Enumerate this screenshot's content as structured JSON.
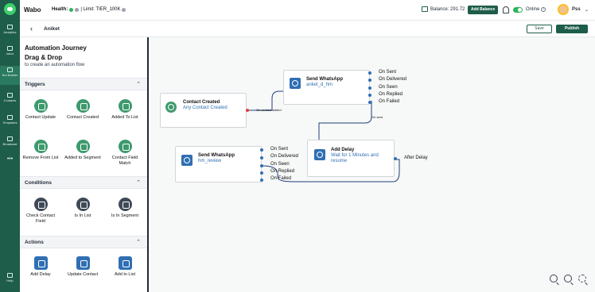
{
  "app": {
    "brand": "Wabo"
  },
  "topbar": {
    "health_label": "Health:",
    "limit_label": "| Limit: TIER_100K",
    "balance_label": "Balance: 291.72",
    "add_balance_label": "Add Balance",
    "status_label": "Online",
    "username": "Pss"
  },
  "sidebar": {
    "items": [
      {
        "label": "Analytics",
        "icon": "chart-icon"
      },
      {
        "label": "Inbox",
        "icon": "inbox-icon"
      },
      {
        "label": "Bot Builder",
        "icon": "bot-icon"
      },
      {
        "label": "Contacts",
        "icon": "contacts-icon"
      },
      {
        "label": "Templates",
        "icon": "templates-icon"
      },
      {
        "label": "Broadcast",
        "icon": "broadcast-icon"
      },
      {
        "label": "•••",
        "icon": "more-icon"
      },
      {
        "label": "Help",
        "icon": "help-icon"
      }
    ]
  },
  "subbar": {
    "flow_name": "Aniket",
    "save_label": "Save",
    "publish_label": "Publish"
  },
  "panel": {
    "title": "Automation Journey",
    "subtitle": "Drag & Drop",
    "description": "to create an automation flow",
    "sections": {
      "triggers": "Triggers",
      "conditions": "Conditions",
      "actions": "Actions"
    },
    "triggers": [
      "Contact Update",
      "Contact Created",
      "Added To List",
      "Remove From List",
      "Added to Segment",
      "Contact Field Match"
    ],
    "conditions": [
      "Check Contact Field",
      "Is In List",
      "Is In Segment"
    ],
    "actions": [
      "Add Delay",
      "Update Contact",
      "Add to List"
    ]
  },
  "canvas": {
    "node_contact_created": {
      "title": "Contact Created",
      "subtitle": "Any Contact Created"
    },
    "node_send_wa_1": {
      "title": "Send WhatsApp",
      "subtitle": "anket_d_hm"
    },
    "node_send_wa_2": {
      "title": "Send WhatsApp",
      "subtitle": "hm_review"
    },
    "node_add_delay": {
      "title": "Add Delay",
      "subtitle": "Wait for 1 Minutes and resume"
    },
    "wa_options": [
      "On Sent",
      "On Delivered",
      "On Seen",
      "On Replied",
      "On Failed"
    ],
    "after_delay_label": "After Delay",
    "edge_contact_added": "On contact added",
    "edge_on_sent": "On sent"
  },
  "colors": {
    "brand": "#1e5d4a",
    "accent_blue": "#2f6fb3",
    "trigger_green": "#3e9a6d"
  }
}
